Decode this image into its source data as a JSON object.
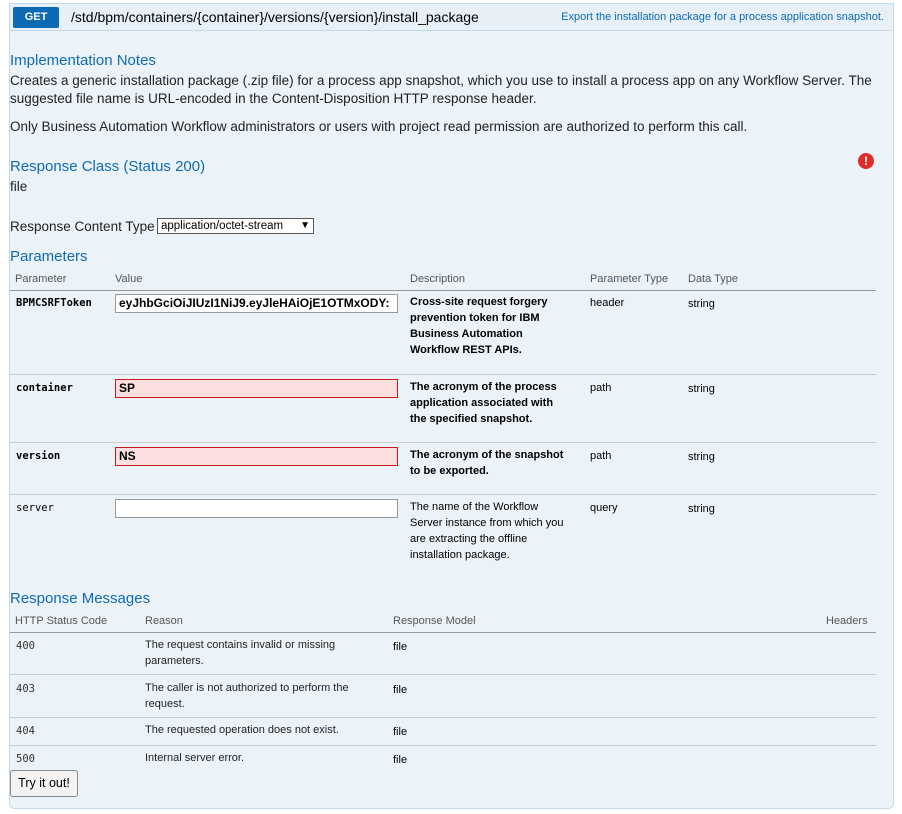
{
  "operation": {
    "method": "GET",
    "path": "/std/bpm/containers/{container}/versions/{version}/install_package",
    "summary": "Export the installation package for a process application snapshot."
  },
  "notes": {
    "title": "Implementation Notes",
    "line1": "Creates a generic installation package (.zip file) for a process app snapshot, which you use to install a process app on any Workflow Server. The",
    "line2": "suggested file name is URL-encoded in the Content-Disposition HTTP response header.",
    "line3": "Only Business Automation Workflow administrators or users with project read permission are authorized to perform this call."
  },
  "response_class": {
    "title": "Response Class (Status 200)",
    "value": "file",
    "error_icon": "!"
  },
  "content_type": {
    "label": "Response Content Type",
    "selected": "application/octet-stream",
    "chevron": "▼"
  },
  "parameters": {
    "title": "Parameters",
    "columns": [
      "Parameter",
      "Value",
      "Description",
      "Parameter Type",
      "Data Type"
    ],
    "rows": [
      {
        "name": "BPMCSRFToken",
        "value": "eyJhbGciOiJIUzI1NiJ9.eyJleHAiOjE1OTMxODY:",
        "desc": [
          "Cross-site request forgery",
          "prevention token for IBM",
          "Business Automation",
          "Workflow REST APIs."
        ],
        "param_type": "header",
        "data_type": "string"
      },
      {
        "name": "container",
        "value": "SP",
        "desc": [
          "The acronym of the process",
          "application associated with",
          "the specified snapshot."
        ],
        "param_type": "path",
        "data_type": "string"
      },
      {
        "name": "version",
        "value": "NS",
        "desc": [
          "The acronym of the snapshot",
          "to be exported."
        ],
        "param_type": "path",
        "data_type": "string"
      },
      {
        "name": "server",
        "value": "",
        "desc": [
          "The name of the Workflow",
          "Server instance from which you",
          "are extracting the offline",
          "installation package."
        ],
        "param_type": "query",
        "data_type": "string"
      }
    ]
  },
  "responses": {
    "title": "Response Messages",
    "columns": [
      "HTTP Status Code",
      "Reason",
      "Response Model",
      "Headers"
    ],
    "rows": [
      {
        "code": "400",
        "reason": [
          "The request contains invalid or missing",
          "parameters."
        ],
        "model": "file"
      },
      {
        "code": "403",
        "reason": [
          "The caller is not authorized to perform the",
          "request."
        ],
        "model": "file"
      },
      {
        "code": "404",
        "reason": [
          "The requested operation does not exist."
        ],
        "model": "file"
      },
      {
        "code": "500",
        "reason": [
          "Internal server error."
        ],
        "model": "file"
      }
    ]
  },
  "try_button": "Try it out!",
  "colors": {
    "accent": "#0f6ab4",
    "panel": "#ebf3f9",
    "error": "#e02b2b",
    "invalid_bg": "#fce0e0",
    "invalid_border": "#c41a1a"
  }
}
